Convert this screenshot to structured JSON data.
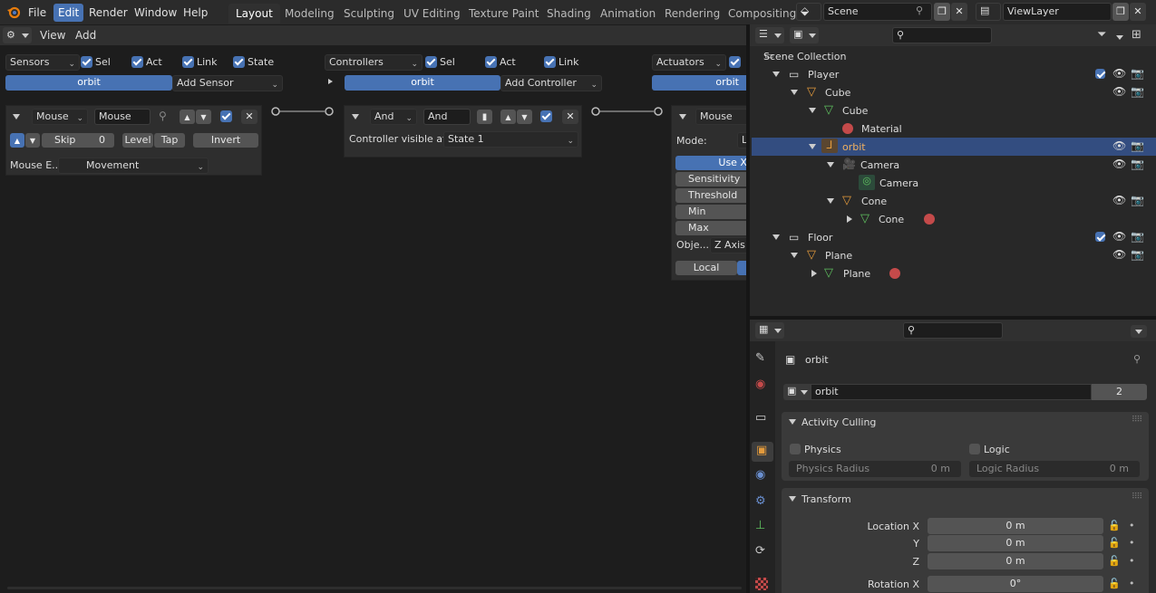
{
  "menu": {
    "file": "File",
    "edit": "Edit",
    "render": "Render",
    "window": "Window",
    "help": "Help"
  },
  "workspaces": [
    "Layout",
    "Modeling",
    "Sculpting",
    "UV Editing",
    "Texture Paint",
    "Shading",
    "Animation",
    "Rendering",
    "Compositing"
  ],
  "scene": {
    "name": "Scene",
    "view_layer": "ViewLayer"
  },
  "logic_header": {
    "view": "View",
    "add": "Add"
  },
  "sensors": {
    "title": "Sensors",
    "sel": "Sel",
    "act": "Act",
    "link": "Link",
    "state": "State",
    "object": "orbit",
    "add_label": "Add Sensor",
    "sensor_type": "Mouse",
    "sensor_name": "Mouse",
    "skip_label": "Skip",
    "skip_value": "0",
    "level": "Level",
    "tap": "Tap",
    "invert": "Invert",
    "mouse_event_label": "Mouse E...",
    "mouse_event_value": "Movement"
  },
  "controllers": {
    "title": "Controllers",
    "sel": "Sel",
    "act": "Act",
    "link": "Link",
    "object": "orbit",
    "add_label": "Add Controller",
    "controller_type": "And",
    "controller_name": "And",
    "visible_label": "Controller visible at:",
    "state_value": "State 1"
  },
  "actuators": {
    "title": "Actuators",
    "object": "orbit",
    "actuator_type": "Mouse",
    "mode_label": "Mode:",
    "mode_value": "L",
    "use_x": "Use X A",
    "sensitivity": "Sensitivity",
    "threshold": "Threshold",
    "min": "Min",
    "max": "Max",
    "object_axis_label": "Obje...",
    "object_axis_value": "Z Axis",
    "local": "Local"
  },
  "outliner": {
    "rows": [
      {
        "label": "Scene Collection"
      },
      {
        "label": "Player"
      },
      {
        "label": "Cube"
      },
      {
        "label": "Cube"
      },
      {
        "label": "Material"
      },
      {
        "label": "orbit"
      },
      {
        "label": "Camera"
      },
      {
        "label": "Camera"
      },
      {
        "label": "Cone"
      },
      {
        "label": "Cone"
      },
      {
        "label": "Floor"
      },
      {
        "label": "Plane"
      },
      {
        "label": "Plane"
      }
    ]
  },
  "properties": {
    "object_name": "orbit",
    "datablock_name": "orbit",
    "users": "2",
    "activity_culling": "Activity Culling",
    "physics": "Physics",
    "logic": "Logic",
    "physics_radius": "Physics Radius",
    "physics_radius_value": "0 m",
    "logic_radius": "Logic Radius",
    "logic_radius_value": "0 m",
    "transform": "Transform",
    "location_x_label": "Location X",
    "location_x": "0 m",
    "y_label": "Y",
    "y": "0 m",
    "z_label": "Z",
    "z": "0 m",
    "rotation_x_label": "Rotation X",
    "rotation_x": "0°"
  },
  "colors": {
    "accent": "#4772b3",
    "selection": "#334d80",
    "object_orange": "#e39a3c",
    "mesh_green": "#5fc15f",
    "material_red": "#c44a4a"
  }
}
